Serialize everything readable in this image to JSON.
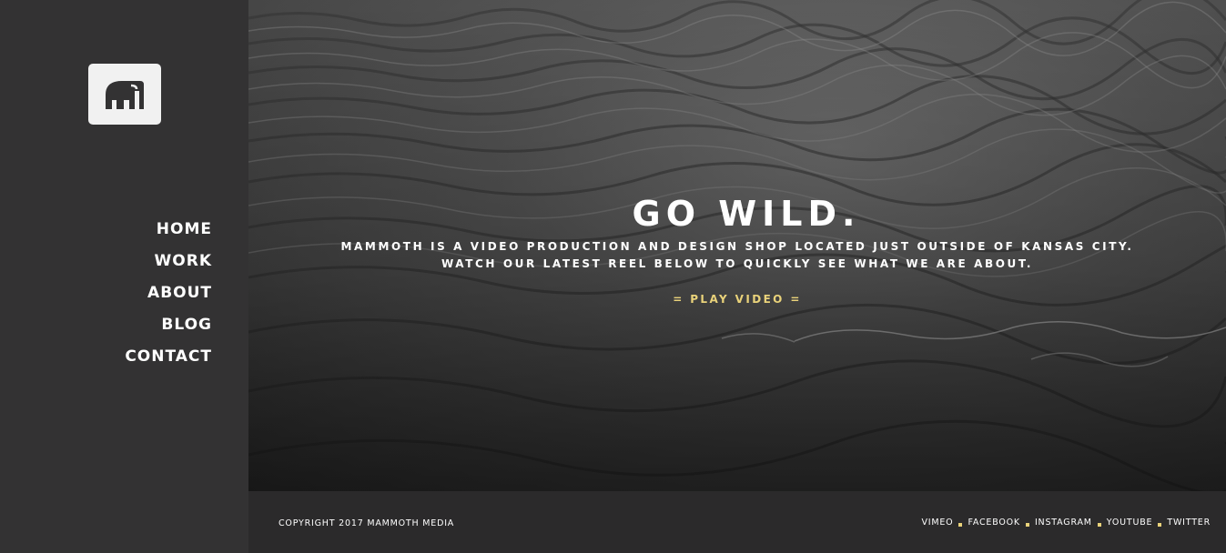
{
  "brand": {
    "logo_icon": "mammoth-logo-icon",
    "accent_color": "#e9d27a"
  },
  "nav": {
    "items": [
      {
        "label": "HOME"
      },
      {
        "label": "WORK"
      },
      {
        "label": "ABOUT"
      },
      {
        "label": "BLOG"
      },
      {
        "label": "CONTACT"
      }
    ]
  },
  "hero": {
    "headline": "GO WILD.",
    "tagline_line1": "MAMMOTH IS A VIDEO PRODUCTION AND DESIGN SHOP LOCATED JUST OUTSIDE OF KANSAS CITY.",
    "tagline_line2": "WATCH OUR LATEST REEL BELOW TO QUICKLY SEE WHAT WE ARE ABOUT.",
    "play_label": "= PLAY VIDEO ="
  },
  "footer": {
    "copyright": "COPYRIGHT 2017 MAMMOTH MEDIA",
    "social": [
      {
        "label": "VIMEO"
      },
      {
        "label": "FACEBOOK"
      },
      {
        "label": "INSTAGRAM"
      },
      {
        "label": "YOUTUBE"
      },
      {
        "label": "TWITTER"
      }
    ]
  }
}
